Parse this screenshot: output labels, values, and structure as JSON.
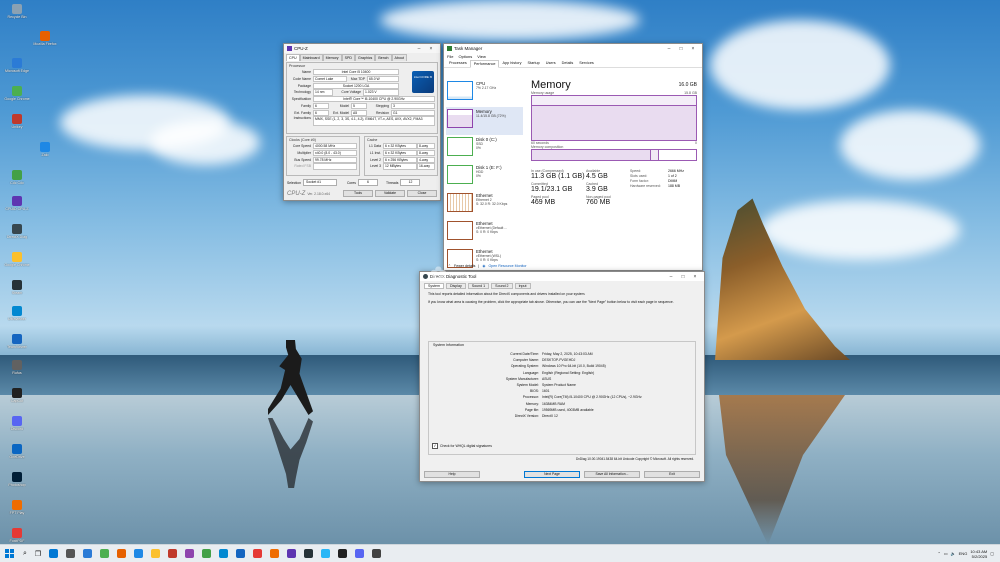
{
  "desktop": {
    "icons": [
      {
        "label": "Recycle Bin",
        "color": "#8aa1b3"
      },
      {
        "label": "Mozilla Firefox",
        "color": "#e66000"
      },
      {
        "label": "Microsoft Edge",
        "color": "#2b7bd6"
      },
      {
        "label": "Google Chrome",
        "color": "#4caf50"
      },
      {
        "label": "Unikey",
        "color": "#c0392b"
      },
      {
        "label": "Zalo",
        "color": "#1e88e5"
      },
      {
        "label": "Cốc Cốc",
        "color": "#43a047"
      },
      {
        "label": "CPUID CPU-Z",
        "color": "#5e35b1"
      },
      {
        "label": "DirectX Diag",
        "color": "#37474f"
      },
      {
        "label": "Google Chrome",
        "color": "#fbc02d"
      },
      {
        "label": "Steam",
        "color": "#263238"
      },
      {
        "label": "Ultraviewer",
        "color": "#0288d1"
      },
      {
        "label": "TeamViewer",
        "color": "#1565c0"
      },
      {
        "label": "Rufus",
        "color": "#616161"
      },
      {
        "label": "CapCut",
        "color": "#212121"
      },
      {
        "label": "Discord",
        "color": "#5865f2"
      },
      {
        "label": "OneDrive",
        "color": "#0a66c2"
      },
      {
        "label": "Photoshop",
        "color": "#001e36"
      },
      {
        "label": "FPT Play",
        "color": "#ef6c00"
      },
      {
        "label": "FoxitPDF",
        "color": "#e53935"
      },
      {
        "label": "Telegram",
        "color": "#29b6f6"
      }
    ]
  },
  "cpuz": {
    "title": "CPU-Z",
    "tabs": [
      "CPU",
      "Mainboard",
      "Memory",
      "SPD",
      "Graphics",
      "Bench",
      "About"
    ],
    "processor_group": "Processor",
    "name_label": "Name",
    "name": "Intel Core i5 10400",
    "codename_label": "Code Name",
    "codename": "Comet Lake",
    "maxtdp_label": "Max TDP",
    "maxtdp": "65.0 W",
    "package_label": "Package",
    "package": "Socket 1200 LGA",
    "tech_label": "Technology",
    "tech": "14 nm",
    "voltage_label": "Core Voltage",
    "voltage": "1.023 V",
    "spec_label": "Specification",
    "spec": "Intel® Core™ i5-10400 CPU @ 2.90GHz",
    "family_label": "Family",
    "family": "6",
    "model_label": "Model",
    "model": "5",
    "stepping_label": "Stepping",
    "stepping": "3",
    "extfamily_label": "Ext. Family",
    "extfamily": "6",
    "extmodel_label": "Ext. Model",
    "extmodel": "A5",
    "revision_label": "Revision",
    "revision": "G1",
    "instr_label": "Instructions",
    "instr": "MMX, SSE (1, 2, 3, 3S, 4.1, 4.2), EM64T, VT-x, AES, AVX, AVX2, FMA3",
    "badge": "intel CORE i5",
    "clocks_group": "Clocks (Core #0)",
    "corespeed_label": "Core Speed",
    "corespeed": "4000.58 MHz",
    "mult_label": "Multiplier",
    "mult": "x40.0 (8.0 - 43.0)",
    "bus_label": "Bus Speed",
    "bus": "99.78 MHz",
    "fsb_label": "Rated FSB",
    "fsb": "",
    "cache_group": "Cache",
    "l1d_label": "L1 Data",
    "l1d": "6 x 32 KBytes",
    "l1d_way": "8-way",
    "l1i_label": "L1 Inst.",
    "l1i": "6 x 32 KBytes",
    "l1i_way": "8-way",
    "l2_label": "Level 2",
    "l2": "6 x 256 KBytes",
    "l2_way": "4-way",
    "l3_label": "Level 3",
    "l3": "12 MBytes",
    "l3_way": "16-way",
    "selection_label": "Selection",
    "selection": "Socket #1",
    "cores_label": "Cores",
    "cores": "6",
    "threads_label": "Threads",
    "threads": "12",
    "logo": "CPU-Z",
    "version": "Ver. 2.18.0.x64",
    "tools": "Tools",
    "validate": "Validate",
    "close": "Close"
  },
  "taskmgr": {
    "title": "Task Manager",
    "menu": [
      "File",
      "Options",
      "View"
    ],
    "tabs": [
      "Processes",
      "Performance",
      "App history",
      "Startup",
      "Users",
      "Details",
      "Services"
    ],
    "side": [
      {
        "name": "CPU",
        "sub": "7% 2.17 GHz",
        "color": "#1e88e5"
      },
      {
        "name": "Memory",
        "sub": "11.4/15.8 GB (72%)",
        "color": "#8e44ad"
      },
      {
        "name": "Disk 0 (C:)",
        "sub": "SSD",
        "sub2": "0%",
        "color": "#4caf50"
      },
      {
        "name": "Disk 1 (E: F:)",
        "sub": "HDD",
        "sub2": "0%",
        "color": "#4caf50"
      },
      {
        "name": "Ethernet",
        "sub": "Ethernet 2",
        "sub2": "S: 32.0 R: 32.0 Kbps",
        "color": "#a0522d"
      },
      {
        "name": "Ethernet",
        "sub": "vEthernet (Default ...",
        "sub2": "S: 0 R: 0 Kbps",
        "color": "#a0522d"
      },
      {
        "name": "Ethernet",
        "sub": "vEthernet (WSL)",
        "sub2": "S: 0 R: 0 Kbps",
        "color": "#a0522d"
      }
    ],
    "main_title": "Memory",
    "total": "16.0 GB",
    "usage_label": "Memory usage",
    "usage_max": "15.8 GB",
    "seconds": "60 seconds",
    "zero": "0",
    "composition_label": "Memory composition",
    "inuse_label": "In use (Compressed)",
    "inuse": "11.3 GB (1.1 GB)",
    "available_label": "Available",
    "available": "4.5 GB",
    "committed_label": "Committed",
    "committed": "19.1/23.1 GB",
    "cached_label": "Cached",
    "cached": "3.9 GB",
    "paged_label": "Paged pool",
    "paged": "469 MB",
    "nonpaged_label": "Non-paged pool",
    "nonpaged": "760 MB",
    "speed_label": "Speed:",
    "speed": "2666 MHz",
    "slots_label": "Slots used:",
    "slots": "1 of 2",
    "form_label": "Form factor:",
    "form": "DIMM",
    "hw_label": "Hardware reserved:",
    "hw": "188 MB",
    "fewer": "Fewer details",
    "monitor": "Open Resource Monitor"
  },
  "dxdiag": {
    "title": "DirectX Diagnostic Tool",
    "tabs": [
      "System",
      "Display",
      "Sound 1",
      "Sound 2",
      "Input"
    ],
    "intro": "This tool reports detailed information about the DirectX components and drivers installed on your system.",
    "intro2": "If you know what area is causing the problem, click the appropriate tab above. Otherwise, you can use the \"Next Page\" button below to visit each page in sequence.",
    "sysinfo": "System Information",
    "rows": [
      {
        "k": "Current Date/Time:",
        "v": "Friday, May 2, 2025, 10:43:03 AM"
      },
      {
        "k": "Computer Name:",
        "v": "DESKTOP-PVGEHDJ"
      },
      {
        "k": "Operating System:",
        "v": "Windows 10 Pro 64-bit (10.0, Build 19045)"
      },
      {
        "k": "Language:",
        "v": "English (Regional Setting: English)"
      },
      {
        "k": "System Manufacturer:",
        "v": "ASUS"
      },
      {
        "k": "System Model:",
        "v": "System Product Name"
      },
      {
        "k": "BIOS:",
        "v": "1601"
      },
      {
        "k": "Processor:",
        "v": "Intel(R) Core(TM) i5-10400 CPU @ 2.90GHz (12 CPUs), ~2.9GHz"
      },
      {
        "k": "Memory:",
        "v": "16384MB RAM"
      },
      {
        "k": "Page file:",
        "v": "19569MB used, 4003MB available"
      },
      {
        "k": "DirectX Version:",
        "v": "DirectX 12"
      }
    ],
    "check": "Check for WHQL digital signatures",
    "copyright": "DxDiag 10.00.19041.5438 64-bit Unicode  Copyright © Microsoft. All rights reserved.",
    "help": "Help",
    "next": "Next Page",
    "save": "Save All Information...",
    "exit": "Exit"
  },
  "taskbar": {
    "icons": [
      "#0078d4",
      "#555",
      "#2b7bd6",
      "#4caf50",
      "#e66000",
      "#1e88e5",
      "#fbc02d",
      "#c0392b",
      "#8e44ad",
      "#43a047",
      "#0288d1",
      "#1565c0",
      "#e53935",
      "#ef6c00",
      "#5e35b1",
      "#263238",
      "#29b6f6",
      "#212121",
      "#5865f2",
      "#424242"
    ],
    "time": "10:43 AM",
    "date": "5/2/2025",
    "lang": "ENG"
  }
}
